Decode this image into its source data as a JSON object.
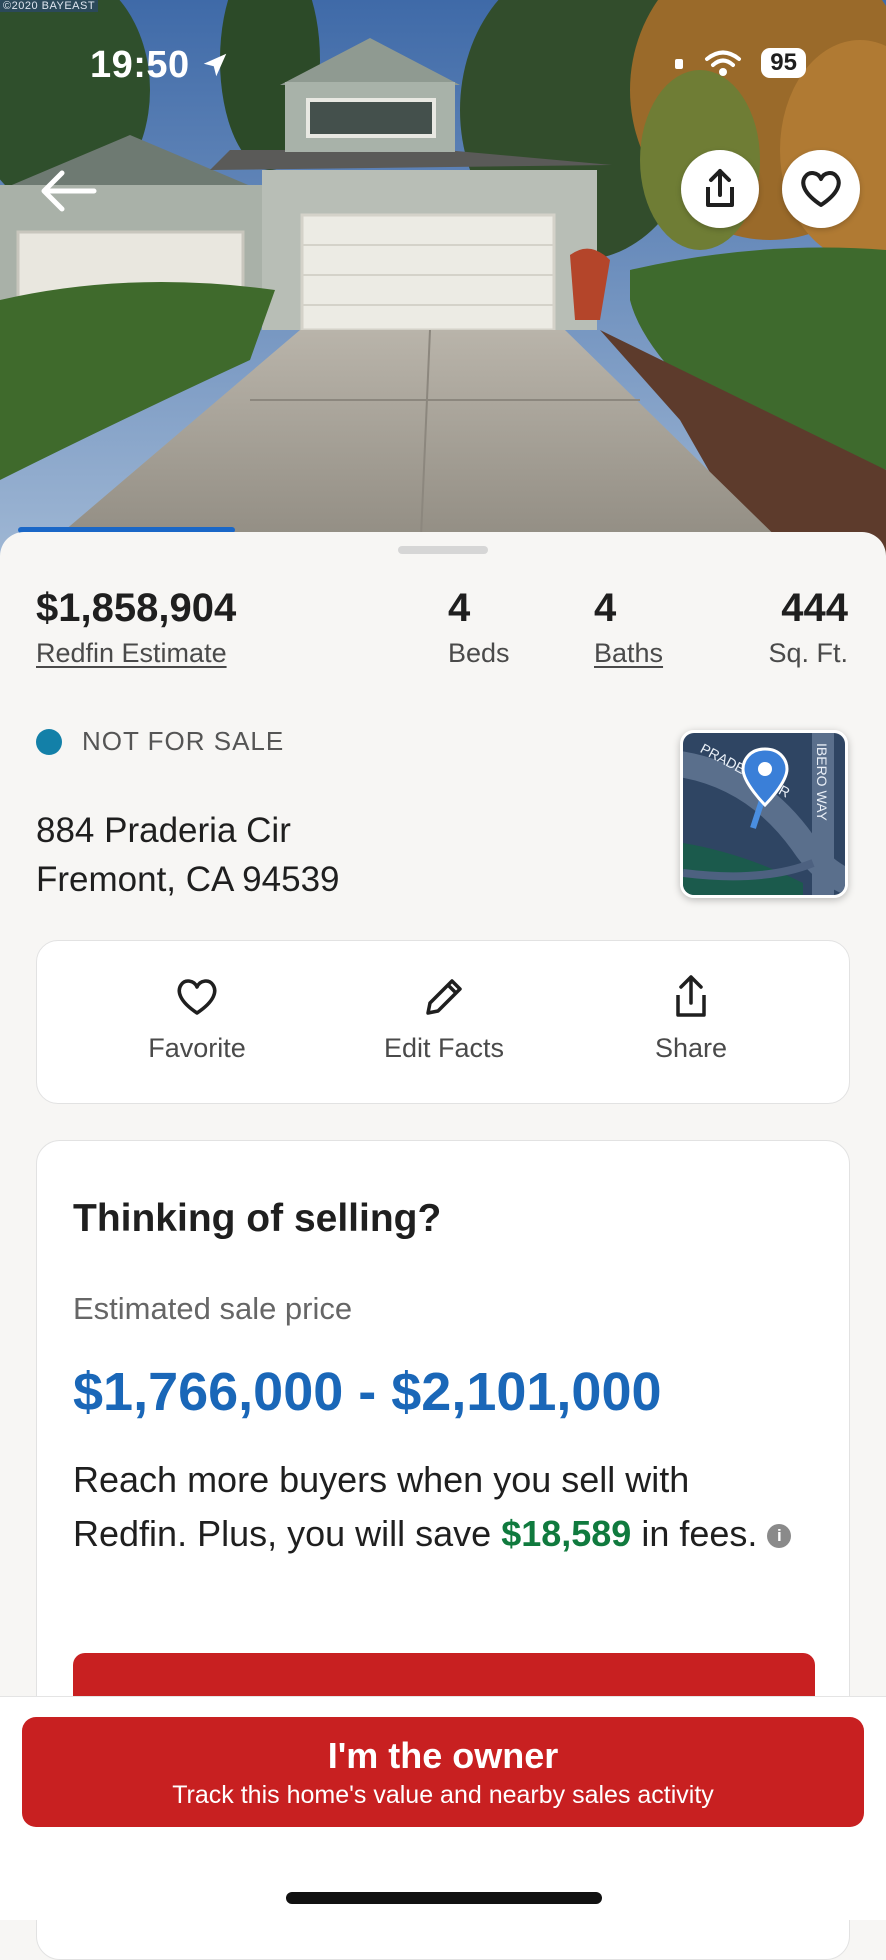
{
  "status_bar": {
    "time": "19:50",
    "battery": "95"
  },
  "photo": {
    "watermark": "©2020 BAYEAST"
  },
  "hero_buttons": {
    "back_icon": "arrow-left-icon",
    "share_icon": "share-icon",
    "favorite_icon": "heart-icon"
  },
  "stats": {
    "price": "$1,858,904",
    "price_label": "Redfin Estimate",
    "beds": "4",
    "beds_label": "Beds",
    "baths": "4",
    "baths_label": "Baths",
    "sqft": "444",
    "sqft_label": "Sq. Ft."
  },
  "listing_status": {
    "text": "NOT FOR SALE",
    "color": "#1380a8"
  },
  "address": {
    "line1": "884 Praderia Cir",
    "line2": "Fremont, CA 94539"
  },
  "map": {
    "street1": "PRADERIA CIR",
    "street2": "IBERO WAY"
  },
  "actions": [
    {
      "label": "Favorite",
      "icon": "heart-icon"
    },
    {
      "label": "Edit Facts",
      "icon": "pencil-icon"
    },
    {
      "label": "Share",
      "icon": "share-icon"
    }
  ],
  "selling": {
    "title": "Thinking of selling?",
    "subtitle": "Estimated sale price",
    "range": "$1,766,000 - $2,101,000",
    "body_1": "Reach more buyers when you sell with Redfin. Plus, you will save ",
    "savings": "$18,589",
    "body_2": " in fees.",
    "info_icon": "i"
  },
  "owner_cta": {
    "title": "I'm the owner",
    "subtitle": "Track this home's value and nearby sales activity"
  },
  "colors": {
    "brand_red": "#c82021",
    "link_blue": "#1a67b8",
    "savings_green": "#107a3e"
  }
}
